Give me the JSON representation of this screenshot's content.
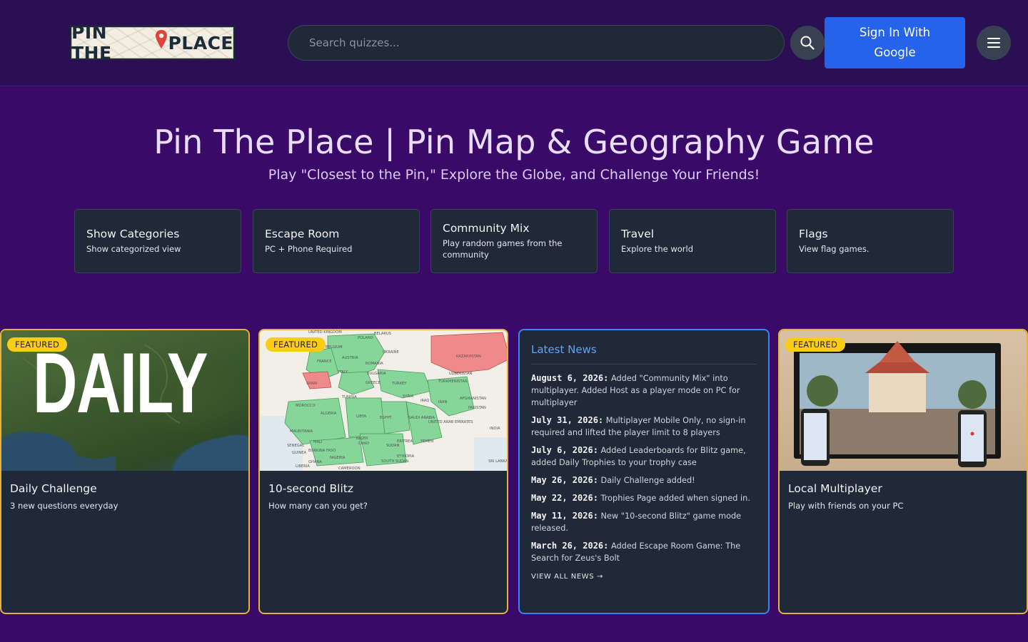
{
  "header": {
    "logo_text_left": "PIN THE",
    "logo_text_right": "PLACE",
    "search_placeholder": "Search quizzes...",
    "signin_label": "Sign In With Google",
    "search_icon": "search-icon",
    "menu_icon": "hamburger-menu-icon"
  },
  "hero": {
    "title": "Pin The Place | Pin Map & Geography Game",
    "subtitle": "Play \"Closest to the Pin,\" Explore the Globe, and Challenge Your Friends!"
  },
  "categories": [
    {
      "title": "Show Categories",
      "desc": "Show categorized view"
    },
    {
      "title": "Escape Room",
      "desc": "PC + Phone Required"
    },
    {
      "title": "Community Mix",
      "desc": "Play random games from the community"
    },
    {
      "title": "Travel",
      "desc": "Explore the world"
    },
    {
      "title": "Flags",
      "desc": "View flag games."
    }
  ],
  "cards": [
    {
      "badge": "FEATURED",
      "image_text": "DAILY",
      "title": "Daily Challenge",
      "desc": "3 new questions everyday"
    },
    {
      "badge": "FEATURED",
      "title": "10-second Blitz",
      "desc": "How many can you get?",
      "map_labels": [
        "UNITED KINGDOM",
        "POLAND",
        "BELARUS",
        "BELGIUM",
        "UKRAINE",
        "AUSTRIA",
        "FRANCE",
        "ROMANIA",
        "ITALY",
        "BULGARIA",
        "KAZAKHSTAN",
        "SPAIN",
        "GREECE",
        "TURKEY",
        "UZBEKISTAN",
        "TURKMENISTAN",
        "TUNISIA",
        "SYRIA",
        "IRAQ",
        "AFGHANISTAN",
        "MOROCCO",
        "IRAN",
        "PAKISTAN",
        "ALGERIA",
        "LIBYA",
        "EGYPT",
        "SAUDI ARABIA",
        "UNITED ARAB EMIRATES",
        "INDIA",
        "MAURITANIA",
        "MALI",
        "NIGER",
        "CHAD",
        "SUDAN",
        "ERITREA",
        "YEMEN",
        "SENEGAL",
        "GUINEA",
        "BURKINA FASO",
        "NIGERIA",
        "ETHIOPIA",
        "GHANA",
        "SOUTH SUDAN",
        "LIBERIA",
        "CAMEROON",
        "SRI LANKA"
      ]
    },
    {
      "badge": "FEATURED",
      "title": "Local Multiplayer",
      "desc": "Play with friends on your PC"
    }
  ],
  "news": {
    "title": "Latest News",
    "items": [
      {
        "date": "August 6, 2026:",
        "text": "Added \"Community Mix\" into multiplayer. Added Host as a player mode on PC for multiplayer"
      },
      {
        "date": "July 31, 2026:",
        "text": "Multiplayer Mobile Only, no sign-in required and lifted the player limit to 8 players"
      },
      {
        "date": "July 6, 2026:",
        "text": "Added Leaderboards for Blitz game, added Daily Trophies to your trophy case"
      },
      {
        "date": "May 26, 2026:",
        "text": "Daily Challenge added!"
      },
      {
        "date": "May 22, 2026:",
        "text": "Trophies Page added when signed in."
      },
      {
        "date": "May 11, 2026:",
        "text": "New \"10-second Blitz\" game mode released."
      },
      {
        "date": "March 26, 2026:",
        "text": "Added Escape Room Game: The Search for Zeus's Bolt"
      }
    ],
    "view_all": "VIEW ALL NEWS →"
  },
  "colors": {
    "page_bg": "#3a0a68",
    "header_bg": "#2a1052",
    "card_bg": "#1f2937",
    "featured_border": "#e5b33a",
    "news_border": "#3b82f6",
    "primary_button": "#2563eb",
    "badge": "#facc15"
  }
}
